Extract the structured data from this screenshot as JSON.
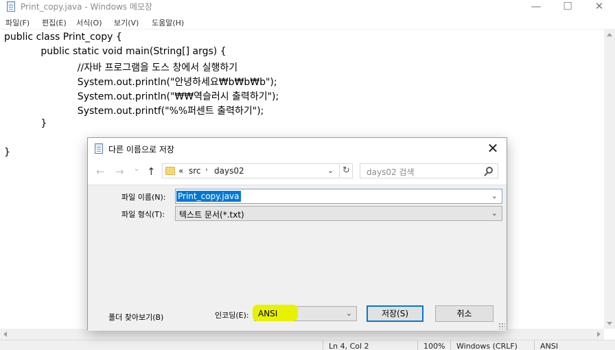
{
  "window": {
    "title": "Print_copy.java - Windows 메모장",
    "minimize_glyph": "—",
    "maximize_glyph": "☐",
    "close_glyph": "✕"
  },
  "menu": {
    "items": [
      "파일(F)",
      "편집(E)",
      "서식(O)",
      "보기(V)",
      "도움말(H)"
    ]
  },
  "editor": {
    "lines": [
      "public class Print_copy {",
      "            public static void main(String[] args) {",
      "                        //자바 프로그램을 도스 창에서 실행하기",
      "                        System.out.println(\"안녕하세요₩b₩b₩b\");",
      "                        System.out.println(\"₩₩역슬러시 출력하기\");",
      "                        System.out.printf(\"%%퍼센트 출력하기\");",
      "            }",
      "",
      "}"
    ]
  },
  "statusbar": {
    "position": "Ln 4, Col 2",
    "zoom": "100%",
    "line_ending": "Windows (CRLF)",
    "encoding": "ANSI"
  },
  "dialog": {
    "title": "다른 이름으로 저장",
    "close_glyph": "✕",
    "nav": {
      "back": "←",
      "forward": "→",
      "recent": "⌄",
      "up": "↑",
      "breadcrumb_prefix": "«",
      "breadcrumb": [
        "src",
        "days02"
      ],
      "refresh": "↻",
      "search_placeholder": "days02 검색"
    },
    "filename": {
      "label": "파일 이름(N):",
      "value": "Print_copy.java"
    },
    "filetype": {
      "label": "파일 형식(T):",
      "value": "텍스트 문서(*.txt)"
    },
    "browse_folders": "폴더 찾아보기(B)",
    "encoding": {
      "label": "인코딩(E):",
      "value": "ANSI"
    },
    "save_button": "저장(S)",
    "cancel_button": "취소",
    "colors": {
      "highlight": "#e8f200",
      "selection": "#0078d7"
    }
  }
}
